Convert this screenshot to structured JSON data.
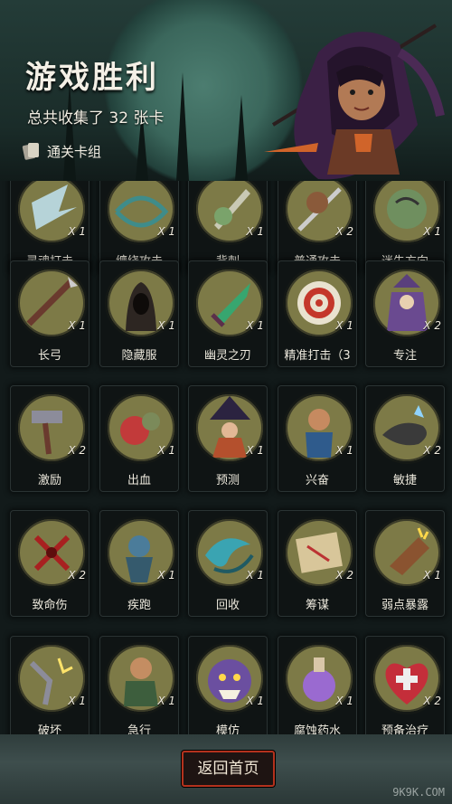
{
  "header": {
    "title": "游戏胜利",
    "collected_text": "总共收集了 32 张卡",
    "deck_label": "通关卡组"
  },
  "cards": [
    {
      "name": "灵魂打击",
      "count": "X 1",
      "art": "spirit-strike-art"
    },
    {
      "name": "缠绕攻击",
      "count": "X 1",
      "art": "entangle-attack-art"
    },
    {
      "name": "背刺",
      "count": "X 1",
      "art": "backstab-art"
    },
    {
      "name": "普通攻击",
      "count": "X 2",
      "art": "basic-attack-art"
    },
    {
      "name": "迷失方向",
      "count": "X 1",
      "art": "disorient-art"
    },
    {
      "name": "长弓",
      "count": "X 1",
      "art": "longbow-art"
    },
    {
      "name": "隐藏服",
      "count": "X 1",
      "art": "hooded-cloak-art"
    },
    {
      "name": "幽灵之刃",
      "count": "X 1",
      "art": "ghost-blade-art"
    },
    {
      "name": "精准打击（3",
      "count": "X 1",
      "art": "target-arrows-art"
    },
    {
      "name": "专注",
      "count": "X 2",
      "art": "wizard-art"
    },
    {
      "name": "激励",
      "count": "X 2",
      "art": "hammer-art"
    },
    {
      "name": "出血",
      "count": "X 1",
      "art": "bleeding-monster-art"
    },
    {
      "name": "预测",
      "count": "X 1",
      "art": "witch-art"
    },
    {
      "name": "兴奋",
      "count": "X 1",
      "art": "excited-dwarf-art"
    },
    {
      "name": "敏捷",
      "count": "X 2",
      "art": "panther-art"
    },
    {
      "name": "致命伤",
      "count": "X 2",
      "art": "blood-wound-art"
    },
    {
      "name": "疾跑",
      "count": "X 1",
      "art": "running-goblin-art"
    },
    {
      "name": "回收",
      "count": "X 1",
      "art": "swirl-art"
    },
    {
      "name": "筹谋",
      "count": "X 2",
      "art": "map-art"
    },
    {
      "name": "弱点暴露",
      "count": "X 1",
      "art": "boot-art"
    },
    {
      "name": "破坏",
      "count": "X 1",
      "art": "shattered-hammer-art"
    },
    {
      "name": "急行",
      "count": "X 1",
      "art": "dashing-dwarf-art"
    },
    {
      "name": "模仿",
      "count": "X 1",
      "art": "ogre-face-art"
    },
    {
      "name": "腐蚀药水",
      "count": "X 1",
      "art": "potion-art"
    },
    {
      "name": "预备治疗",
      "count": "X 2",
      "art": "heart-cross-art"
    }
  ],
  "back_button": "返回首页",
  "watermark": "9K9K.COM",
  "colors": {
    "medal": "#7d7a47",
    "button_border": "#b4321d",
    "background": "#121a1a"
  }
}
